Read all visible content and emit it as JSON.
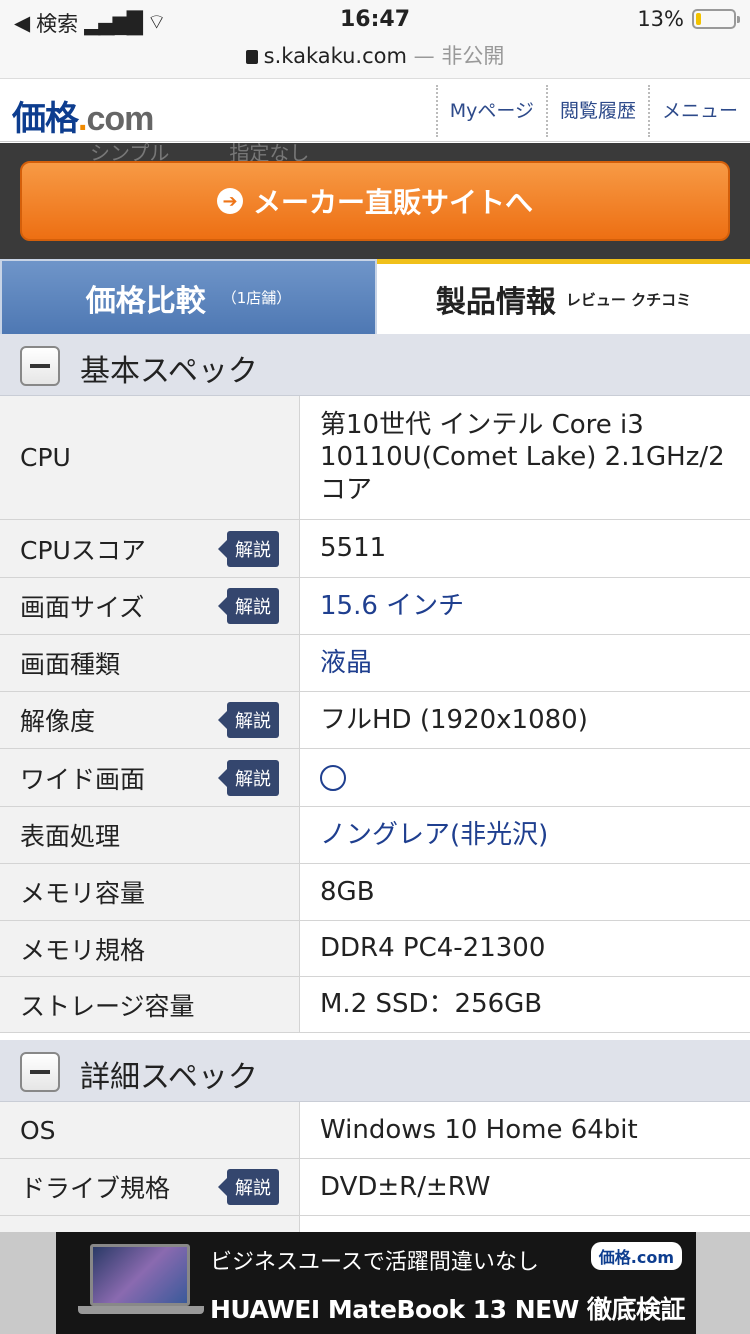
{
  "status": {
    "back_app": "検索",
    "time": "16:47",
    "battery": "13%"
  },
  "url": {
    "domain": "s.kakaku.com",
    "suffix": " — 非公開"
  },
  "header": {
    "logo_main": "価格",
    "logo_dot": ".",
    "logo_com": "com",
    "nav": [
      "Myページ",
      "閲覧履歴",
      "メニュー"
    ]
  },
  "band_ghost": "シンプル　　　指定なし",
  "maker_button": "メーカー直販サイトへ",
  "tabs": {
    "price": {
      "main": "価格比較",
      "sub": "（1店舗）"
    },
    "info": {
      "main": "製品情報",
      "sub": "レビュー クチコミ"
    }
  },
  "basic_spec": {
    "title": "基本スペック",
    "rows": [
      {
        "label": "CPU",
        "value": "第10世代 インテル Core i3 10110U(Comet Lake) 2.1GHz/2コア"
      },
      {
        "label": "CPUスコア",
        "badge": "解説",
        "value": "5511"
      },
      {
        "label": "画面サイズ",
        "badge": "解説",
        "value": "15.6 インチ"
      },
      {
        "label": "画面種類",
        "value": "液晶"
      },
      {
        "label": "解像度",
        "badge": "解説",
        "value": "フルHD (1920x1080)"
      },
      {
        "label": "ワイド画面",
        "badge": "解説"
      },
      {
        "label": "表面処理",
        "value": "ノングレア(非光沢)"
      },
      {
        "label": "メモリ容量",
        "value": "8GB"
      },
      {
        "label": "メモリ規格",
        "value": "DDR4 PC4-21300"
      },
      {
        "label": "ストレージ容量",
        "value": "M.2 SSD：256GB"
      }
    ]
  },
  "detail_spec": {
    "title": "詳細スペック",
    "rows": [
      {
        "label": "OS",
        "value": "Windows 10 Home 64bit"
      },
      {
        "label": "ドライブ規格",
        "badge": "解説",
        "value": "DVD±R/±RW"
      }
    ]
  },
  "ad": {
    "top": "ビジネスユースで活躍間違いなし",
    "bottom": "HUAWEI MateBook 13 NEW 徹底検証",
    "logo": "価格.com"
  }
}
